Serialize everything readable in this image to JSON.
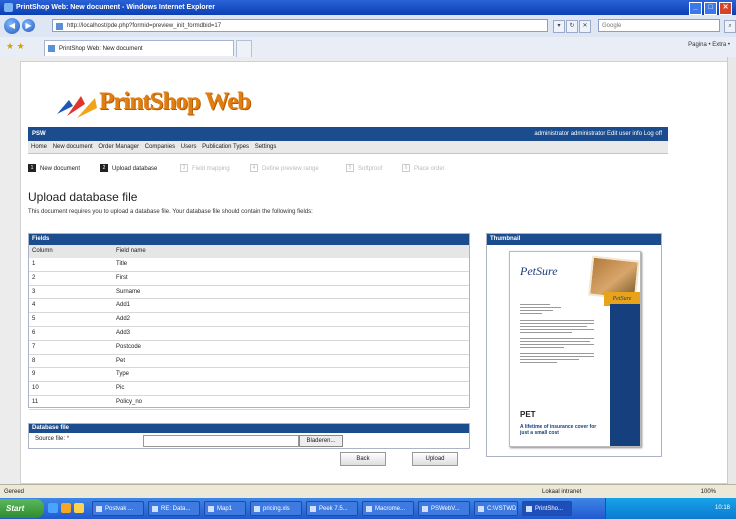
{
  "window": {
    "title": "PrintShop Web: New document - Windows Internet Explorer"
  },
  "address": {
    "url": "http://localhost/pde.php?formid=preview_init_formdbid=17",
    "search_placeholder": "Google"
  },
  "tab": {
    "label": "PrintShop Web: New document"
  },
  "toolbar": {
    "tools": "Pagina • Extra •"
  },
  "logo": {
    "text": "PrintShop Web"
  },
  "header": {
    "left": "PSW",
    "user": "administrator administrator",
    "edit": "Edit user info",
    "logoff": "Log off"
  },
  "menu": [
    "Home",
    "New document",
    "Order Manager",
    "Companies",
    "Users",
    "Publication Types",
    "Settings"
  ],
  "steps": [
    {
      "n": "1",
      "label": "New document"
    },
    {
      "n": "2",
      "label": "Upload database"
    },
    {
      "n": "3",
      "label": "Field mapping"
    },
    {
      "n": "4",
      "label": "Define preview range"
    },
    {
      "n": "5",
      "label": "Softproof"
    },
    {
      "n": "6",
      "label": "Place order"
    }
  ],
  "page": {
    "title": "Upload database file",
    "description": "This document requires you to upload a database file. Your database file should contain the following fields:"
  },
  "fields_table": {
    "title": "Fields",
    "col1": "Column",
    "col2": "Field name",
    "rows": [
      [
        "1",
        "Title"
      ],
      [
        "2",
        "First"
      ],
      [
        "3",
        "Surname"
      ],
      [
        "4",
        "Add1"
      ],
      [
        "5",
        "Add2"
      ],
      [
        "6",
        "Add3"
      ],
      [
        "7",
        "Postcode"
      ],
      [
        "8",
        "Pet"
      ],
      [
        "9",
        "Type"
      ],
      [
        "10",
        "Pic"
      ],
      [
        "11",
        "Policy_no"
      ]
    ]
  },
  "thumbnail": {
    "title": "Thumbnail",
    "brand": "PetSure",
    "logo": "PET",
    "tagline": "A lifetime of insurance cover for just a small cost"
  },
  "database": {
    "title": "Database file",
    "label": "Source file:",
    "required": "*",
    "browse": "Bladeren..."
  },
  "buttons": {
    "back": "Back",
    "upload": "Upload"
  },
  "status": {
    "left": "Gereed",
    "zone": "Lokaal intranet",
    "zoom": "100%"
  },
  "taskbar": {
    "start": "Start",
    "tasks": [
      "Postvak ...",
      "RE: Data...",
      "Map1",
      "pricing.xls",
      "Peek 7.5...",
      "Macrome...",
      "PSWebV...",
      "C:\\VSTWD...",
      "PrintSho..."
    ],
    "time": "10:18"
  }
}
